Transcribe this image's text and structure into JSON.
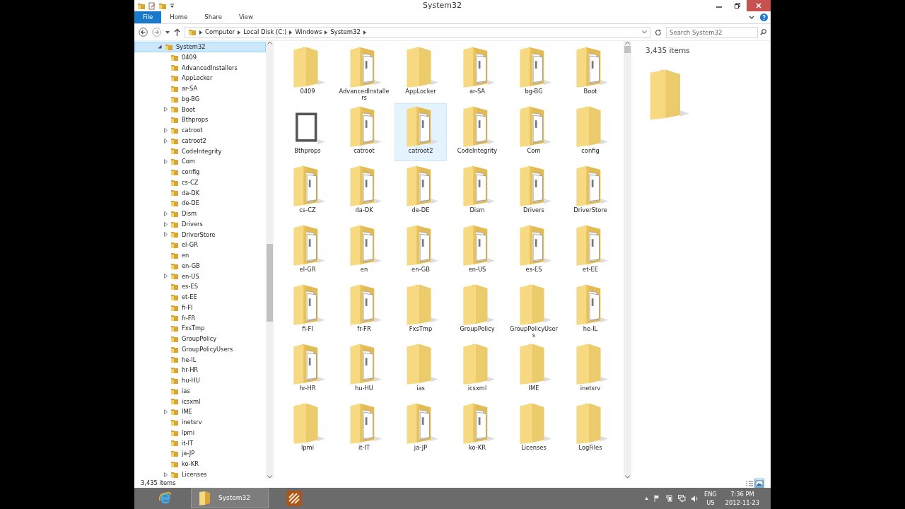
{
  "window": {
    "title": "System32"
  },
  "ribbon_tabs": [
    {
      "label": "File",
      "kind": "file"
    },
    {
      "label": "Home",
      "kind": "tab"
    },
    {
      "label": "Share",
      "kind": "tab"
    },
    {
      "label": "View",
      "kind": "tab"
    }
  ],
  "address": {
    "segments": [
      "Computer",
      "Local Disk (C:)",
      "Windows",
      "System32"
    ],
    "search_placeholder": "Search System32"
  },
  "tree": {
    "label": "System32",
    "expanded": true,
    "selected": true,
    "children": [
      {
        "label": "0409",
        "expandable": false
      },
      {
        "label": "AdvancedInstallers",
        "expandable": false
      },
      {
        "label": "AppLocker",
        "expandable": false
      },
      {
        "label": "ar-SA",
        "expandable": false
      },
      {
        "label": "bg-BG",
        "expandable": false
      },
      {
        "label": "Boot",
        "expandable": true
      },
      {
        "label": "Bthprops",
        "expandable": false
      },
      {
        "label": "catroot",
        "expandable": true
      },
      {
        "label": "catroot2",
        "expandable": true
      },
      {
        "label": "CodeIntegrity",
        "expandable": false
      },
      {
        "label": "Com",
        "expandable": true
      },
      {
        "label": "config",
        "expandable": false
      },
      {
        "label": "cs-CZ",
        "expandable": false
      },
      {
        "label": "da-DK",
        "expandable": false
      },
      {
        "label": "de-DE",
        "expandable": false
      },
      {
        "label": "Dism",
        "expandable": true
      },
      {
        "label": "Drivers",
        "expandable": true
      },
      {
        "label": "DriverStore",
        "expandable": true
      },
      {
        "label": "el-GR",
        "expandable": false
      },
      {
        "label": "en",
        "expandable": false
      },
      {
        "label": "en-GB",
        "expandable": false
      },
      {
        "label": "en-US",
        "expandable": true
      },
      {
        "label": "es-ES",
        "expandable": false
      },
      {
        "label": "et-EE",
        "expandable": false
      },
      {
        "label": "fi-FI",
        "expandable": false
      },
      {
        "label": "fr-FR",
        "expandable": false
      },
      {
        "label": "FxsTmp",
        "expandable": false
      },
      {
        "label": "GroupPolicy",
        "expandable": false
      },
      {
        "label": "GroupPolicyUsers",
        "expandable": false
      },
      {
        "label": "he-IL",
        "expandable": false
      },
      {
        "label": "hr-HR",
        "expandable": false
      },
      {
        "label": "hu-HU",
        "expandable": false
      },
      {
        "label": "ias",
        "expandable": false
      },
      {
        "label": "icsxml",
        "expandable": false
      },
      {
        "label": "IME",
        "expandable": true
      },
      {
        "label": "inetsrv",
        "expandable": false
      },
      {
        "label": "lpmi",
        "expandable": false
      },
      {
        "label": "it-IT",
        "expandable": false
      },
      {
        "label": "ja-JP",
        "expandable": false
      },
      {
        "label": "ko-KR",
        "expandable": false
      },
      {
        "label": "Licenses",
        "expandable": true
      }
    ]
  },
  "items": [
    {
      "label": "0409",
      "kind": "plain",
      "selected": false
    },
    {
      "label": "AdvancedInstallers",
      "kind": "documents",
      "selected": false
    },
    {
      "label": "AppLocker",
      "kind": "plain",
      "selected": false
    },
    {
      "label": "ar-SA",
      "kind": "documents",
      "selected": false
    },
    {
      "label": "bg-BG",
      "kind": "documents",
      "selected": false
    },
    {
      "label": "Boot",
      "kind": "documents",
      "selected": false
    },
    {
      "label": "Bthprops",
      "kind": "frame",
      "selected": false
    },
    {
      "label": "catroot",
      "kind": "documents",
      "selected": false
    },
    {
      "label": "catroot2",
      "kind": "documents",
      "selected": true
    },
    {
      "label": "CodeIntegrity",
      "kind": "documents",
      "selected": false
    },
    {
      "label": "Com",
      "kind": "documents",
      "selected": false
    },
    {
      "label": "config",
      "kind": "plain",
      "selected": false
    },
    {
      "label": "cs-CZ",
      "kind": "documents",
      "selected": false
    },
    {
      "label": "da-DK",
      "kind": "documents",
      "selected": false
    },
    {
      "label": "de-DE",
      "kind": "documents",
      "selected": false
    },
    {
      "label": "Dism",
      "kind": "documents",
      "selected": false
    },
    {
      "label": "Drivers",
      "kind": "documents",
      "selected": false
    },
    {
      "label": "DriverStore",
      "kind": "documents",
      "selected": false
    },
    {
      "label": "el-GR",
      "kind": "documents",
      "selected": false
    },
    {
      "label": "en",
      "kind": "documents",
      "selected": false
    },
    {
      "label": "en-GB",
      "kind": "documents",
      "selected": false
    },
    {
      "label": "en-US",
      "kind": "documents",
      "selected": false
    },
    {
      "label": "es-ES",
      "kind": "documents",
      "selected": false
    },
    {
      "label": "et-EE",
      "kind": "documents",
      "selected": false
    },
    {
      "label": "fi-FI",
      "kind": "documents",
      "selected": false
    },
    {
      "label": "fr-FR",
      "kind": "documents",
      "selected": false
    },
    {
      "label": "FxsTmp",
      "kind": "plain",
      "selected": false
    },
    {
      "label": "GroupPolicy",
      "kind": "plain",
      "selected": false
    },
    {
      "label": "GroupPolicyUsers",
      "kind": "plain",
      "selected": false
    },
    {
      "label": "he-IL",
      "kind": "documents",
      "selected": false
    },
    {
      "label": "hr-HR",
      "kind": "documents",
      "selected": false
    },
    {
      "label": "hu-HU",
      "kind": "documents",
      "selected": false
    },
    {
      "label": "ias",
      "kind": "plain",
      "selected": false
    },
    {
      "label": "icsxml",
      "kind": "plain",
      "selected": false
    },
    {
      "label": "IME",
      "kind": "plain",
      "selected": false
    },
    {
      "label": "inetsrv",
      "kind": "plain",
      "selected": false
    },
    {
      "label": "lpmi",
      "kind": "plain",
      "selected": false
    },
    {
      "label": "it-IT",
      "kind": "documents",
      "selected": false
    },
    {
      "label": "ja-JP",
      "kind": "documents",
      "selected": false
    },
    {
      "label": "ko-KR",
      "kind": "documents",
      "selected": false
    },
    {
      "label": "Licenses",
      "kind": "plain",
      "selected": false
    },
    {
      "label": "LogFiles",
      "kind": "plain",
      "selected": false
    }
  ],
  "preview": {
    "count": "3,435 items"
  },
  "status_bar": {
    "count": "3,435 items",
    "views": [
      {
        "kind": "details",
        "selected": false
      },
      {
        "kind": "large-icons",
        "selected": true
      }
    ]
  },
  "taskbar": {
    "apps": [
      {
        "kind": "browser",
        "active": false
      },
      {
        "kind": "folder",
        "label": "System32",
        "active": true
      },
      {
        "kind": "tiles",
        "active": false
      }
    ],
    "tray": {
      "language": "ENG",
      "region": "US",
      "time": "7:36 PM",
      "date": "2012-11-23"
    }
  }
}
